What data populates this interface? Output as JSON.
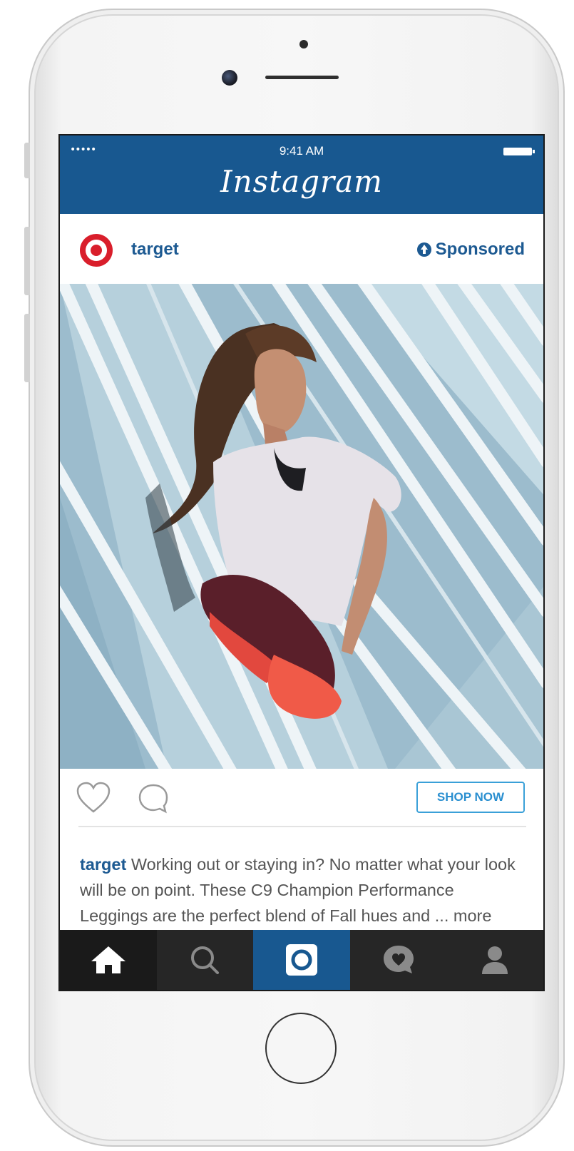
{
  "status_bar": {
    "signal": "•••••",
    "time": "9:41 AM"
  },
  "app": {
    "title": "Instagram"
  },
  "post": {
    "username": "target",
    "sponsored_label": "Sponsored",
    "shop_button": "SHOP NOW",
    "caption_user": "target",
    "caption_text": " Working out or staying in? No matter what your look will be on point. These C9 Champion Performance Leggings are the perfect blend of Fall hues and ... more"
  },
  "tab_bar": {
    "items": [
      "home-icon",
      "search-icon",
      "camera-icon",
      "activity-icon",
      "profile-icon"
    ]
  },
  "colors": {
    "brand_blue": "#185890",
    "target_red": "#d91e2b",
    "shop_button_blue": "#3aa0d8"
  }
}
